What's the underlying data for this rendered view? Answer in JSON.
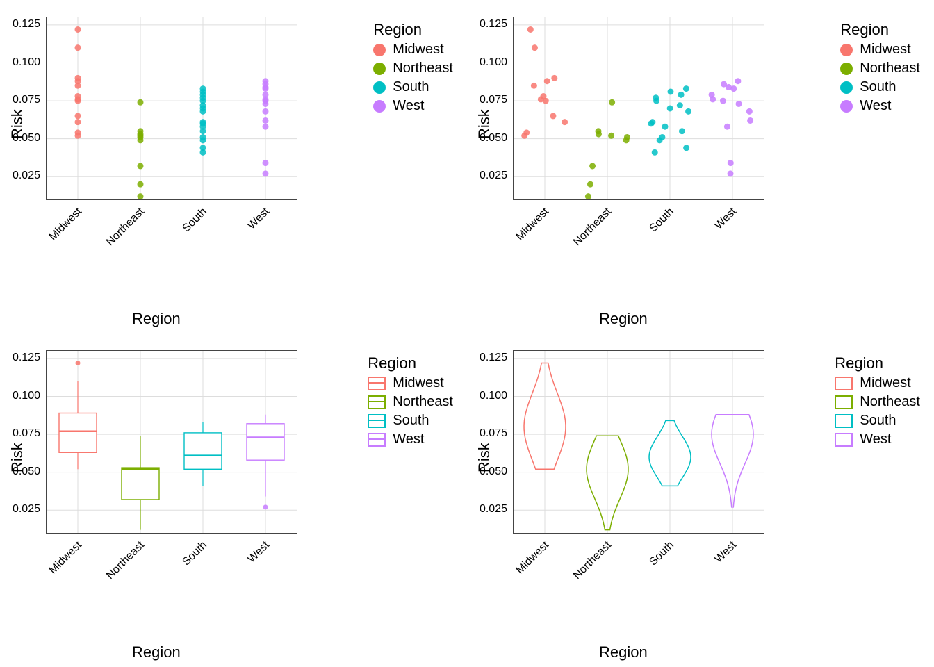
{
  "labels": {
    "xlabel": "Region",
    "ylabel": "Risk",
    "legend_title": "Region"
  },
  "regions": [
    "Midwest",
    "Northeast",
    "South",
    "West"
  ],
  "colors": {
    "Midwest": "#F8766D",
    "Northeast": "#7CAE00",
    "South": "#00BFC4",
    "West": "#C77CFF"
  },
  "y_ticks": [
    0.025,
    0.05,
    0.075,
    0.1,
    0.125
  ],
  "y_tick_labels": [
    "0.025",
    "0.050",
    "0.075",
    "0.100",
    "0.125"
  ],
  "chart_data": [
    {
      "type": "scatter",
      "mode": "strip",
      "title": "",
      "xlabel": "Region",
      "ylabel": "Risk",
      "ylim": [
        0.01,
        0.13
      ],
      "series": [
        {
          "name": "Midwest",
          "values": [
            0.052,
            0.054,
            0.061,
            0.065,
            0.075,
            0.076,
            0.078,
            0.085,
            0.088,
            0.09,
            0.11,
            0.122
          ]
        },
        {
          "name": "Northeast",
          "values": [
            0.012,
            0.02,
            0.032,
            0.049,
            0.051,
            0.052,
            0.053,
            0.055,
            0.074
          ]
        },
        {
          "name": "South",
          "values": [
            0.041,
            0.044,
            0.049,
            0.051,
            0.055,
            0.058,
            0.06,
            0.061,
            0.068,
            0.07,
            0.072,
            0.075,
            0.077,
            0.079,
            0.081,
            0.083
          ]
        },
        {
          "name": "West",
          "values": [
            0.027,
            0.034,
            0.058,
            0.062,
            0.068,
            0.073,
            0.075,
            0.076,
            0.079,
            0.083,
            0.084,
            0.086,
            0.088
          ]
        }
      ]
    },
    {
      "type": "scatter",
      "mode": "jitter",
      "title": "",
      "xlabel": "Region",
      "ylabel": "Risk",
      "ylim": [
        0.01,
        0.13
      ],
      "series": [
        {
          "name": "Midwest",
          "values": [
            0.052,
            0.054,
            0.061,
            0.065,
            0.075,
            0.076,
            0.078,
            0.085,
            0.088,
            0.09,
            0.11,
            0.122
          ]
        },
        {
          "name": "Northeast",
          "values": [
            0.012,
            0.02,
            0.032,
            0.049,
            0.051,
            0.052,
            0.053,
            0.055,
            0.074
          ]
        },
        {
          "name": "South",
          "values": [
            0.041,
            0.044,
            0.049,
            0.051,
            0.055,
            0.058,
            0.06,
            0.061,
            0.068,
            0.07,
            0.072,
            0.075,
            0.077,
            0.079,
            0.081,
            0.083
          ]
        },
        {
          "name": "West",
          "values": [
            0.027,
            0.034,
            0.058,
            0.062,
            0.068,
            0.073,
            0.075,
            0.076,
            0.079,
            0.083,
            0.084,
            0.086,
            0.088
          ]
        }
      ]
    },
    {
      "type": "box",
      "title": "",
      "xlabel": "Region",
      "ylabel": "Risk",
      "ylim": [
        0.01,
        0.13
      ],
      "categories": [
        "Midwest",
        "Northeast",
        "South",
        "West"
      ],
      "series": [
        {
          "name": "Midwest",
          "q1": 0.063,
          "median": 0.077,
          "q3": 0.089,
          "lo": 0.052,
          "hi": 0.11,
          "outliers": [
            0.122
          ]
        },
        {
          "name": "Northeast",
          "q1": 0.032,
          "median": 0.052,
          "q3": 0.053,
          "lo": 0.012,
          "hi": 0.074,
          "outliers": []
        },
        {
          "name": "South",
          "q1": 0.052,
          "median": 0.061,
          "q3": 0.076,
          "lo": 0.041,
          "hi": 0.083,
          "outliers": []
        },
        {
          "name": "West",
          "q1": 0.058,
          "median": 0.073,
          "q3": 0.082,
          "lo": 0.034,
          "hi": 0.088,
          "outliers": [
            0.027
          ]
        }
      ]
    },
    {
      "type": "violin",
      "title": "",
      "xlabel": "Region",
      "ylabel": "Risk",
      "ylim": [
        0.01,
        0.13
      ],
      "categories": [
        "Midwest",
        "Northeast",
        "South",
        "West"
      ],
      "series": [
        {
          "name": "Midwest",
          "lo": 0.052,
          "hi": 0.122,
          "widest_at": 0.08
        },
        {
          "name": "Northeast",
          "lo": 0.012,
          "hi": 0.074,
          "widest_at": 0.052
        },
        {
          "name": "South",
          "lo": 0.041,
          "hi": 0.084,
          "widest_at": 0.06
        },
        {
          "name": "West",
          "lo": 0.027,
          "hi": 0.088,
          "widest_at": 0.075
        }
      ]
    }
  ]
}
